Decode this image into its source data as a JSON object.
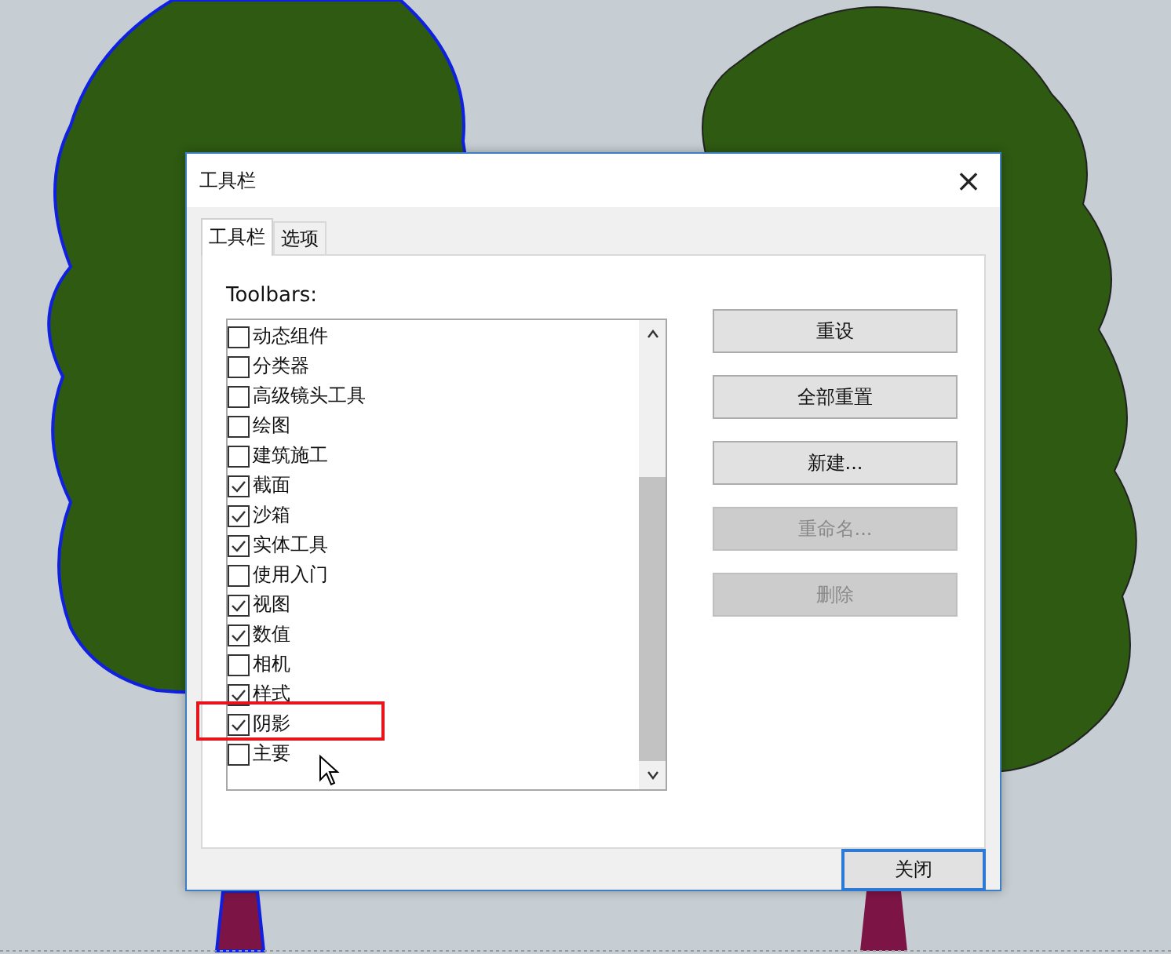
{
  "window": {
    "title": "工具栏",
    "close_glyph": "×"
  },
  "tabs": [
    {
      "label": "工具栏",
      "selected": true
    },
    {
      "label": "选项",
      "selected": false
    }
  ],
  "toolbars": {
    "label": "Toolbars:",
    "items": [
      {
        "name": "动态组件",
        "checked": false,
        "marked": false
      },
      {
        "name": "分类器",
        "checked": false,
        "marked": false
      },
      {
        "name": "高级镜头工具",
        "checked": false,
        "marked": false
      },
      {
        "name": "绘图",
        "checked": false,
        "marked": false
      },
      {
        "name": "建筑施工",
        "checked": false,
        "marked": false
      },
      {
        "name": "截面",
        "checked": true,
        "marked": false
      },
      {
        "name": "沙箱",
        "checked": true,
        "marked": false
      },
      {
        "name": "实体工具",
        "checked": true,
        "marked": false
      },
      {
        "name": "使用入门",
        "checked": false,
        "marked": false
      },
      {
        "name": "视图",
        "checked": true,
        "marked": false
      },
      {
        "name": "数值",
        "checked": true,
        "marked": false
      },
      {
        "name": "相机",
        "checked": false,
        "marked": false
      },
      {
        "name": "样式",
        "checked": true,
        "marked": false
      },
      {
        "name": "阴影",
        "checked": true,
        "marked": true
      },
      {
        "name": "主要",
        "checked": false,
        "marked": false
      }
    ]
  },
  "buttons": [
    {
      "label": "重设",
      "disabled": false
    },
    {
      "label": "全部重置",
      "disabled": false
    },
    {
      "label": "新建...",
      "disabled": false
    },
    {
      "label": "重命名...",
      "disabled": true
    },
    {
      "label": "删除",
      "disabled": true
    }
  ],
  "close_button": {
    "label": "关闭"
  }
}
